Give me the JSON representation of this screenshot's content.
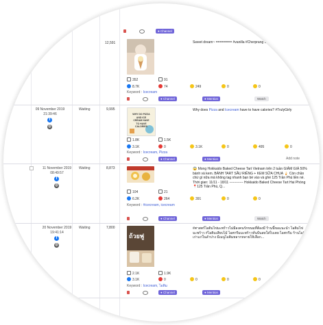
{
  "buttons": {
    "channel": "Channel",
    "mention": "Mention",
    "watch": "Watch",
    "add_note": "Add note"
  },
  "rows": [
    {
      "engagement": "12,591",
      "caption": "Sweet dream~ ======== #vanilla #Cherprang BNK48",
      "stats": {
        "comments": "352",
        "shares": "91",
        "likes": "8.7K",
        "love": "74",
        "haha": "249",
        "wow": "0",
        "sad": "0"
      },
      "keyword_label": "Keyword :",
      "keywords": "Icecream"
    },
    {
      "date": "09 November 2019",
      "time": "21:39:46",
      "status": "Waiting",
      "engagement": "9,995",
      "caption_pre": "Why does ",
      "caption_hl1": "Pizza",
      "caption_mid": " and ",
      "caption_hl2": "Icecream",
      "caption_post": " have to have calories? #TrulyGirly",
      "thumb_text": "WHY DO PIZZA AND ICE CREAM HAVE TO HAVE CALORIES",
      "stats": {
        "comments": "1.8K",
        "shares": "1.5K",
        "likes": "3.1K",
        "love": "0",
        "haha": "3.1K",
        "wow": "0",
        "angry": "495",
        "sad": "0"
      },
      "keyword_label": "Keyword :",
      "keywords": "Icecream, Pizza"
    },
    {
      "date": "11 November 2019",
      "time": "08:49:57",
      "status": "Waiting",
      "engagement": "8,873",
      "caption": "😱 Mong Hokkaido Baked Cheese Tart Vietnam trên 2 tuần GIẢM GIÁ 50% bánh và kem. BÁNH TART SẦU RIÊNG + KEM SỮA CHUA 🍦 Còn chần chừ gì nữa mà không tag nhanh bạn bè vào và ghé 125 Trần Phú liền nè. Thời gian: 11/11 - 18/11 ------------ Hokkaido Baked Cheese Tart Hai Phòng 📍125 Trần Phú, Q...",
      "stats": {
        "comments": "104",
        "shares": "21",
        "likes": "6.2K",
        "love": "264",
        "haha": "391",
        "wow": "0",
        "sad": "0"
      },
      "keyword_label": "Keyword :",
      "keywords": "#icecream, icecream"
    },
    {
      "date": "20 November 2019",
      "time": "19:41:14",
      "status": "Waiting",
      "engagement": "7,800",
      "caption": "#ศาสตร์ไอติมไข่มะพร้าวไม่มีลงคนรักขนมที่ต้องมี ร้านนี้ขอแนะนำ ไอติมไข่มะพร้าว #ไอติมเสียบไม้ ไอศกรีมมะพร้าวหั่นปั่นสดใส่ใบเตย ไอศกรีม ร้านไอติมเก่าแก่ในลำปาง มีเมนูไอติมหลากหลายให้เลือก...",
      "thumb_text": "ถ้วยฟู",
      "stats": {
        "comments": "2.1K",
        "shares": "1.9K",
        "likes": "3.1K",
        "love": "0",
        "haha": "0",
        "wow": "0",
        "sad": "0"
      },
      "keyword_label": "Keyword :",
      "keywords": "Icecream, ไอติม"
    }
  ]
}
